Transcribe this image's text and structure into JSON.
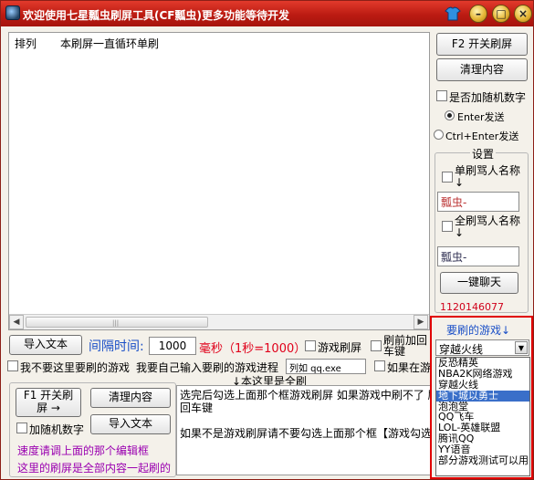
{
  "window": {
    "title": "欢迎使用七星瓢虫刷屏工具(CF瓢虫)更多功能等待开发",
    "buttons": {
      "min": "–",
      "max": "□",
      "close": "×"
    }
  },
  "list": {
    "columns": [
      "排列",
      "本刷屏一直循环单刷"
    ]
  },
  "sidebar": {
    "f2_label": "F2 开关刷屏",
    "clear_label": "清理内容",
    "random_label": "是否加随机数字",
    "enter_label": "Enter发送",
    "ctrl_enter_label": "Ctrl+Enter发送",
    "settings_label": "设置",
    "single_name_label": "单刷骂人名称↓",
    "single_name_value": "瓢虫-",
    "all_name_label": "全刷骂人名称↓",
    "all_name_value": "瓢虫-",
    "chat_label": "一键聊天",
    "qq_link": "1120146077"
  },
  "middle": {
    "import_label": "导入文本",
    "interval_label": "间隔时间:",
    "interval_value": "1000",
    "ms_label": "毫秒（1秒=1000）",
    "game_refresh_label": "游戏刷屏",
    "press_enter_label": "刷前加回车键",
    "not_game_label": "我不要这里要刷的游戏",
    "custom_proc_label": "我要自己输入要刷的游戏进程",
    "proc_value": "列如 qq.exe",
    "if_in_game_label": "如果在游戏",
    "all_brush_label": "↓本这里是全刷"
  },
  "bottom": {
    "f1_label": "F1 开关刷屏 →",
    "clear_label": "清理内容",
    "random_label": "加随机数字",
    "import_label": "导入文本",
    "speed_hint": "速度请调上面的那个编辑框",
    "all_hint": "这里的刷屏是全部内容一起刷的",
    "text_line1": "选完后勾选上面那个框游戏刷屏 如果游戏中刷不了 刷",
    "text_line2": "回车键",
    "text_line3": "如果不是游戏刷屏请不要勾选上面那个框【游戏勾选】"
  },
  "games": {
    "header": "要刷的游戏↓",
    "selected": "穿越火线",
    "items": [
      "反恐精英",
      "NBA2K网络游戏",
      "穿越火线",
      "地下城以勇士",
      "泡泡堂",
      "QQ飞车",
      "LOL-英雄联盟",
      "腾讯QQ",
      "YY语音",
      "部分游戏测试可以用"
    ],
    "selected_index": 3
  },
  "colors": {
    "title_bar": "#c0241a",
    "interval_label": "#1a4fc7",
    "ms_label": "#e0001a",
    "hint_text": "#9a00b0",
    "qq_link": "#d0001a",
    "selection": "#3a6fc9",
    "highlight_box": "#e00000"
  }
}
